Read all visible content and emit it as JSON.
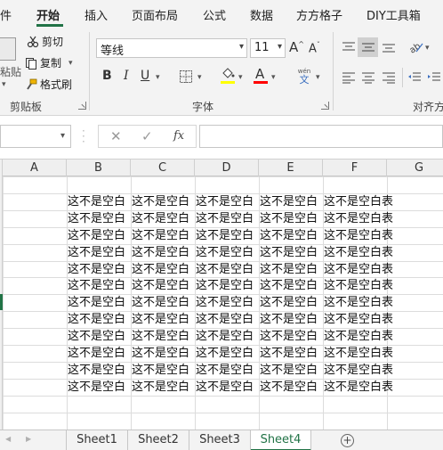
{
  "ribbon_tabs": [
    {
      "label": "件"
    },
    {
      "label": "开始"
    },
    {
      "label": "插入"
    },
    {
      "label": "页面布局"
    },
    {
      "label": "公式"
    },
    {
      "label": "数据"
    },
    {
      "label": "方方格子"
    },
    {
      "label": "DIY工具箱"
    }
  ],
  "clipboard": {
    "paste_label": "粘贴",
    "cut_label": "剪切",
    "copy_label": "复制",
    "format_painter_label": "格式刷",
    "group_label": "剪贴板"
  },
  "font": {
    "font_name": "等线",
    "font_size": "11",
    "grow_label": "A",
    "shrink_label": "A",
    "bold_label": "B",
    "italic_label": "I",
    "underline_label": "U",
    "font_color_label": "A",
    "phonetic_top": "wén",
    "phonetic_bottom": "文",
    "group_label": "字体",
    "fill_color": "#ffff00",
    "font_color": "#ff0000"
  },
  "alignment": {
    "group_label": "对齐方"
  },
  "formula_bar": {
    "cancel_symbol": "✕",
    "enter_symbol": "✓",
    "fx_label": "fx"
  },
  "columns": [
    "A",
    "B",
    "C",
    "D",
    "E",
    "F",
    "G"
  ],
  "cell_truncated_text": "这不是空白",
  "cell_full_text": "这不是空白表",
  "sheet_tabs": [
    {
      "label": "Sheet1",
      "active": false
    },
    {
      "label": "Sheet2",
      "active": false
    },
    {
      "label": "Sheet3",
      "active": false
    },
    {
      "label": "Sheet4",
      "active": true
    }
  ],
  "add_sheet_symbol": "+",
  "accent_color": "#217346"
}
